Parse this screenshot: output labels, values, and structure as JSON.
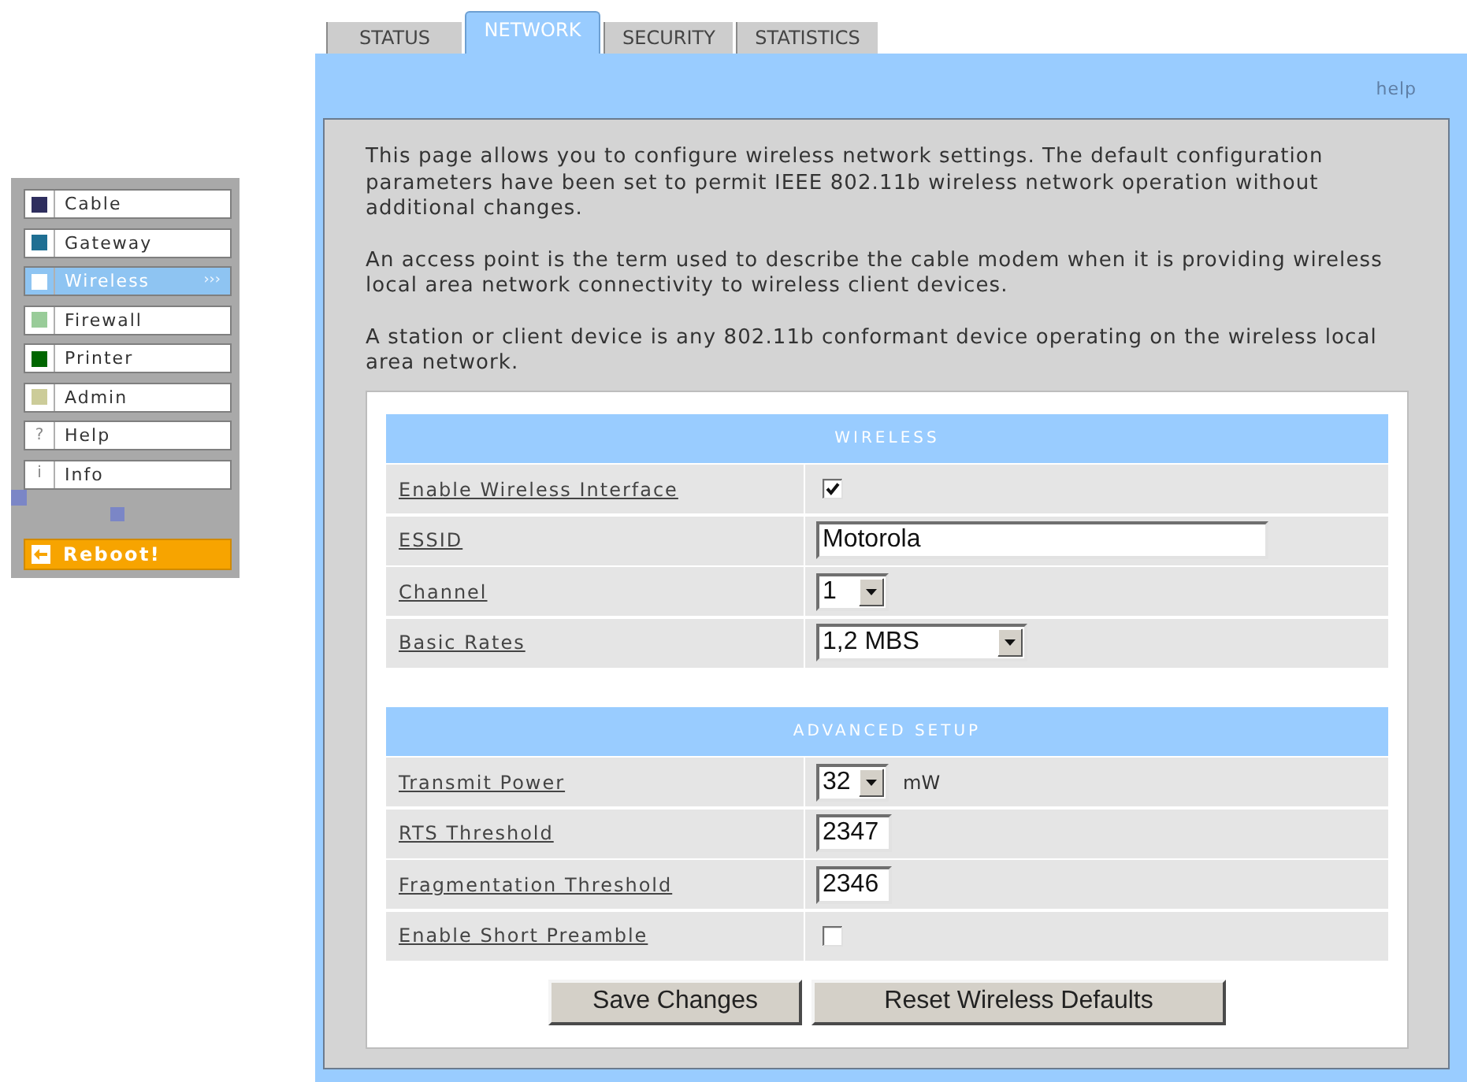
{
  "sidebar": {
    "items": [
      {
        "label": "Cable",
        "kind": "swatch",
        "color": "#2e2e5e",
        "selected": false
      },
      {
        "label": "Gateway",
        "kind": "swatch",
        "color": "#1f6f93",
        "selected": false
      },
      {
        "label": "Wireless",
        "kind": "swatch",
        "color": "#ffffff",
        "selected": true,
        "trail": "›››"
      },
      {
        "label": "Firewall",
        "kind": "swatch",
        "color": "#99cc99",
        "selected": false
      },
      {
        "label": "Printer",
        "kind": "swatch",
        "color": "#006600",
        "selected": false
      },
      {
        "label": "Admin",
        "kind": "swatch",
        "color": "#cccc99",
        "selected": false
      },
      {
        "label": "Help",
        "kind": "glyph",
        "glyph": "?",
        "selected": false
      },
      {
        "label": "Info",
        "kind": "glyph",
        "glyph": "i",
        "selected": false
      }
    ],
    "reboot": {
      "label": "Reboot!"
    }
  },
  "tabs": [
    {
      "label": "STATUS",
      "selected": false
    },
    {
      "label": "NETWORK",
      "selected": true
    },
    {
      "label": "SECURITY",
      "selected": false
    },
    {
      "label": "STATISTICS",
      "selected": false
    }
  ],
  "help_link": "help",
  "intro": [
    "This page allows you to configure wireless network settings. The default configuration parameters have been set to permit IEEE 802.11b wireless network operation without additional changes.",
    "An access point is the term used to describe the cable modem when it is providing wireless local area network connectivity to wireless client devices.",
    "A station or client device is any 802.11b conformant device operating on the wireless local area network."
  ],
  "sections": [
    {
      "title": "WIRELESS",
      "rows": [
        {
          "label": "Enable Wireless Interface",
          "kind": "checkbox",
          "checked": true
        },
        {
          "label": "ESSID",
          "kind": "text",
          "value": "Motorola"
        },
        {
          "label": "Channel",
          "kind": "select",
          "value": "1"
        },
        {
          "label": "Basic Rates",
          "kind": "select",
          "value": "1,2 MBS"
        }
      ]
    },
    {
      "title": "ADVANCED SETUP",
      "rows": [
        {
          "label": "Transmit Power",
          "kind": "select",
          "value": "32",
          "unit": "mW"
        },
        {
          "label": "RTS Threshold",
          "kind": "number",
          "value": "2347"
        },
        {
          "label": "Fragmentation Threshold",
          "kind": "number",
          "value": "2346"
        },
        {
          "label": "Enable Short Preamble",
          "kind": "checkbox",
          "checked": false
        }
      ]
    }
  ],
  "buttons": [
    "Save Changes",
    "Reset Wireless Defaults"
  ]
}
